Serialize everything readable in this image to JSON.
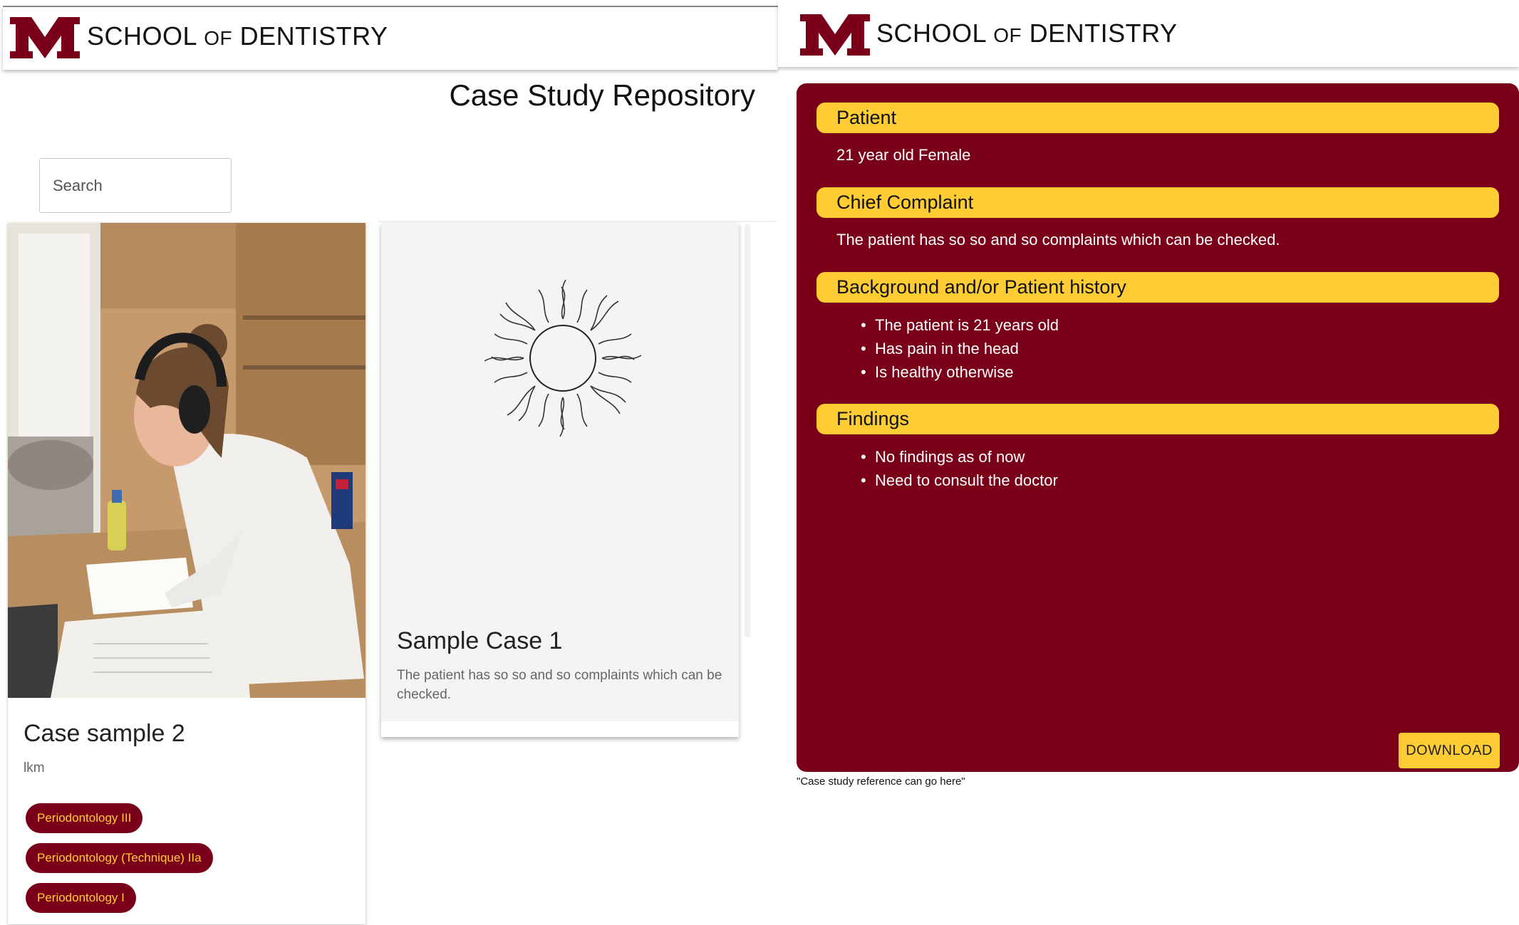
{
  "brand": {
    "school": "SCHOOL",
    "of": "OF",
    "dept": "DENTISTRY",
    "logo_icon": "umn-block-m-logo"
  },
  "colors": {
    "maroon": "#7a0019",
    "gold": "#ffcc33"
  },
  "repository": {
    "title": "Case Study Repository",
    "search": {
      "placeholder": "Search",
      "value": ""
    },
    "cards": [
      {
        "title": "Case sample 2",
        "subtitle": "lkm",
        "image": "student-studying-photo",
        "tags": [
          "Periodontology III",
          "Periodontology (Technique) IIa",
          "Periodontology I"
        ]
      },
      {
        "title": "Sample Case 1",
        "description": "The patient has so so and so complaints which can be checked.",
        "image": "sun-sketch-icon"
      }
    ]
  },
  "case_detail": {
    "sections": [
      {
        "heading": "Patient",
        "text": "21 year old Female"
      },
      {
        "heading": "Chief Complaint",
        "text": "The patient has so so and so complaints which can be checked."
      },
      {
        "heading": "Background and/or Patient history",
        "items": [
          "The patient is 21 years old",
          "Has pain in the head",
          "Is healthy otherwise"
        ]
      },
      {
        "heading": "Findings",
        "items": [
          "No findings as of now",
          "Need to consult the doctor"
        ]
      }
    ],
    "download_label": "DOWNLOAD",
    "reference": "\"Case study reference can go here\""
  }
}
